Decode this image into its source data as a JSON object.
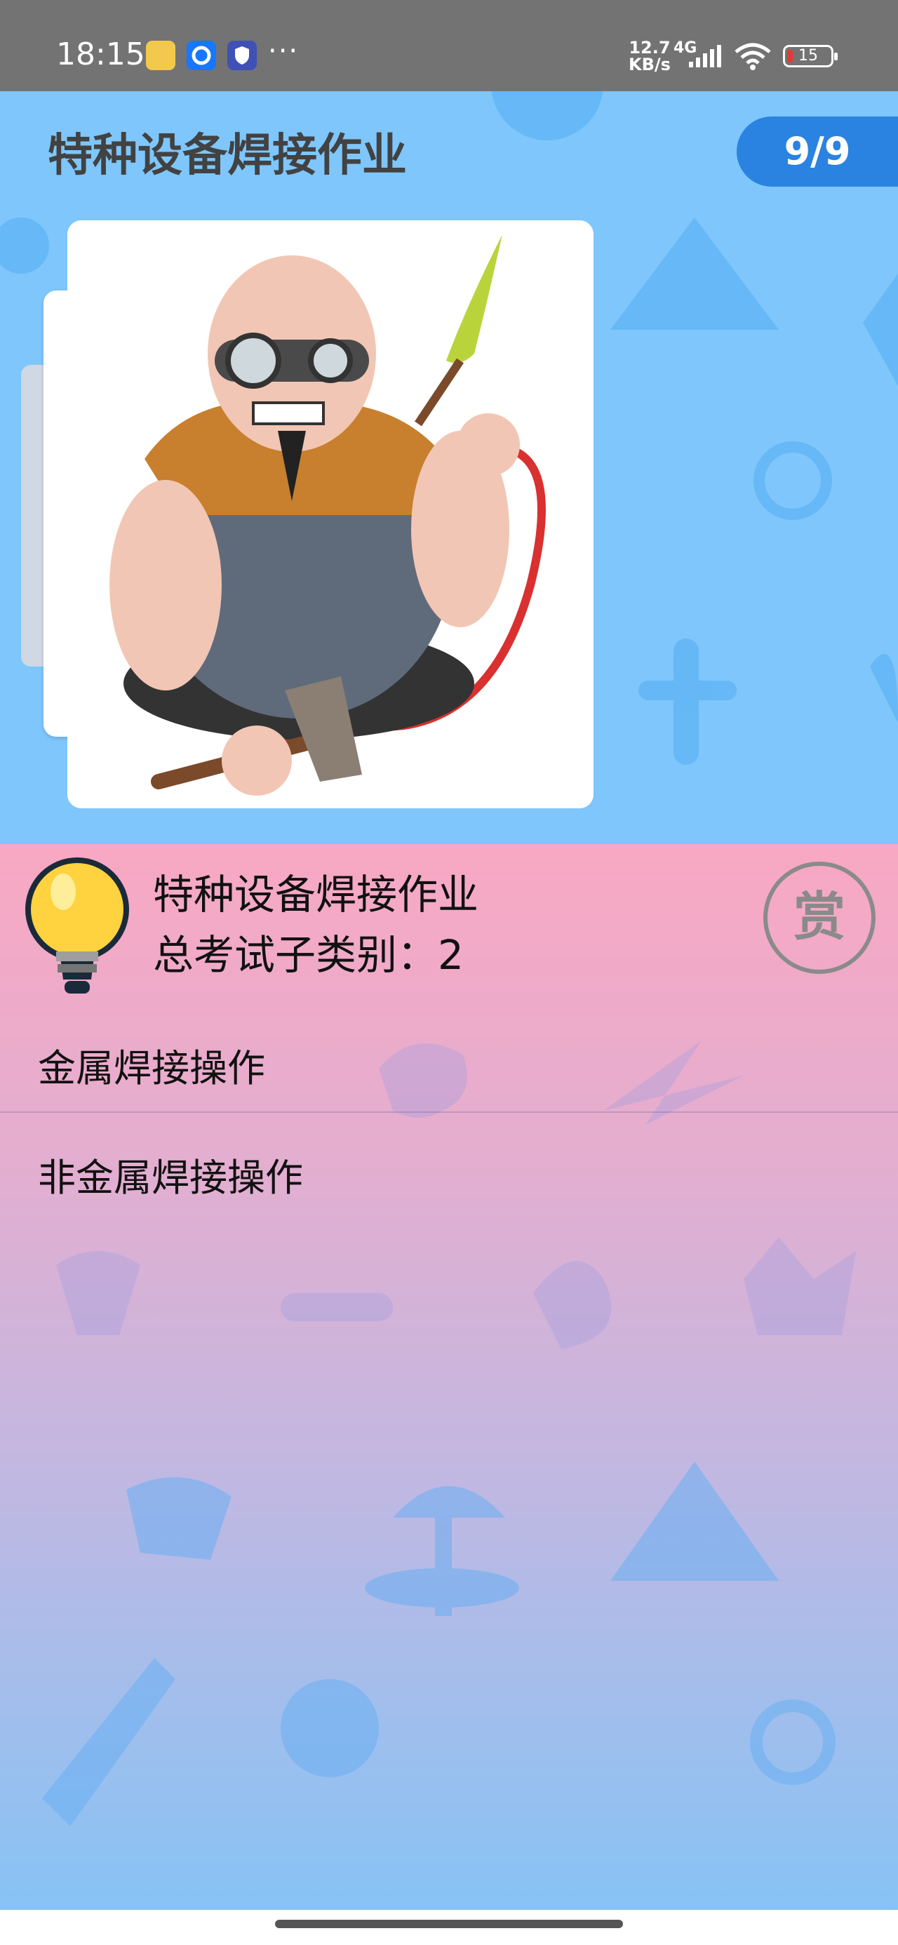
{
  "status_bar": {
    "time": "18:15",
    "more": "···",
    "speed_value": "12.7",
    "speed_unit": "KB/s",
    "network": "4G",
    "battery": "15",
    "icons": [
      "app-icon-1",
      "app-icon-2",
      "vpn-shield-icon",
      "signal-icon",
      "wifi-icon",
      "battery-icon"
    ]
  },
  "header": {
    "title": "特种设备焊接作业",
    "pager": "9/9"
  },
  "card": {
    "image_icon": "welder-illustration"
  },
  "info": {
    "title": "特种设备焊接作业",
    "count_label": "总考试子类别：2",
    "reward_label": "赏"
  },
  "categories": [
    {
      "label": "金属焊接操作"
    },
    {
      "label": "非金属焊接操作"
    }
  ],
  "colors": {
    "sky": "#7ec6fb",
    "pager": "#2a83e0",
    "pink": "#f8a8c2",
    "status_bar": "#737373"
  }
}
